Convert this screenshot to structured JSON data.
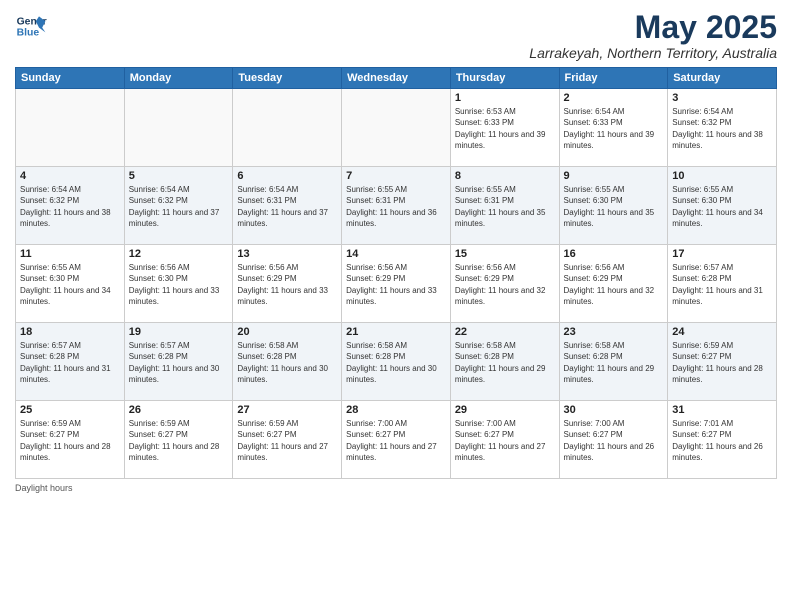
{
  "header": {
    "logo_line1": "General",
    "logo_line2": "Blue",
    "month": "May 2025",
    "location": "Larrakeyah, Northern Territory, Australia"
  },
  "days_of_week": [
    "Sunday",
    "Monday",
    "Tuesday",
    "Wednesday",
    "Thursday",
    "Friday",
    "Saturday"
  ],
  "footer": "Daylight hours",
  "weeks": [
    [
      {
        "day": "",
        "info": ""
      },
      {
        "day": "",
        "info": ""
      },
      {
        "day": "",
        "info": ""
      },
      {
        "day": "",
        "info": ""
      },
      {
        "day": "1",
        "info": "Sunrise: 6:53 AM\nSunset: 6:33 PM\nDaylight: 11 hours and 39 minutes."
      },
      {
        "day": "2",
        "info": "Sunrise: 6:54 AM\nSunset: 6:33 PM\nDaylight: 11 hours and 39 minutes."
      },
      {
        "day": "3",
        "info": "Sunrise: 6:54 AM\nSunset: 6:32 PM\nDaylight: 11 hours and 38 minutes."
      }
    ],
    [
      {
        "day": "4",
        "info": "Sunrise: 6:54 AM\nSunset: 6:32 PM\nDaylight: 11 hours and 38 minutes."
      },
      {
        "day": "5",
        "info": "Sunrise: 6:54 AM\nSunset: 6:32 PM\nDaylight: 11 hours and 37 minutes."
      },
      {
        "day": "6",
        "info": "Sunrise: 6:54 AM\nSunset: 6:31 PM\nDaylight: 11 hours and 37 minutes."
      },
      {
        "day": "7",
        "info": "Sunrise: 6:55 AM\nSunset: 6:31 PM\nDaylight: 11 hours and 36 minutes."
      },
      {
        "day": "8",
        "info": "Sunrise: 6:55 AM\nSunset: 6:31 PM\nDaylight: 11 hours and 35 minutes."
      },
      {
        "day": "9",
        "info": "Sunrise: 6:55 AM\nSunset: 6:30 PM\nDaylight: 11 hours and 35 minutes."
      },
      {
        "day": "10",
        "info": "Sunrise: 6:55 AM\nSunset: 6:30 PM\nDaylight: 11 hours and 34 minutes."
      }
    ],
    [
      {
        "day": "11",
        "info": "Sunrise: 6:55 AM\nSunset: 6:30 PM\nDaylight: 11 hours and 34 minutes."
      },
      {
        "day": "12",
        "info": "Sunrise: 6:56 AM\nSunset: 6:30 PM\nDaylight: 11 hours and 33 minutes."
      },
      {
        "day": "13",
        "info": "Sunrise: 6:56 AM\nSunset: 6:29 PM\nDaylight: 11 hours and 33 minutes."
      },
      {
        "day": "14",
        "info": "Sunrise: 6:56 AM\nSunset: 6:29 PM\nDaylight: 11 hours and 33 minutes."
      },
      {
        "day": "15",
        "info": "Sunrise: 6:56 AM\nSunset: 6:29 PM\nDaylight: 11 hours and 32 minutes."
      },
      {
        "day": "16",
        "info": "Sunrise: 6:56 AM\nSunset: 6:29 PM\nDaylight: 11 hours and 32 minutes."
      },
      {
        "day": "17",
        "info": "Sunrise: 6:57 AM\nSunset: 6:28 PM\nDaylight: 11 hours and 31 minutes."
      }
    ],
    [
      {
        "day": "18",
        "info": "Sunrise: 6:57 AM\nSunset: 6:28 PM\nDaylight: 11 hours and 31 minutes."
      },
      {
        "day": "19",
        "info": "Sunrise: 6:57 AM\nSunset: 6:28 PM\nDaylight: 11 hours and 30 minutes."
      },
      {
        "day": "20",
        "info": "Sunrise: 6:58 AM\nSunset: 6:28 PM\nDaylight: 11 hours and 30 minutes."
      },
      {
        "day": "21",
        "info": "Sunrise: 6:58 AM\nSunset: 6:28 PM\nDaylight: 11 hours and 30 minutes."
      },
      {
        "day": "22",
        "info": "Sunrise: 6:58 AM\nSunset: 6:28 PM\nDaylight: 11 hours and 29 minutes."
      },
      {
        "day": "23",
        "info": "Sunrise: 6:58 AM\nSunset: 6:28 PM\nDaylight: 11 hours and 29 minutes."
      },
      {
        "day": "24",
        "info": "Sunrise: 6:59 AM\nSunset: 6:27 PM\nDaylight: 11 hours and 28 minutes."
      }
    ],
    [
      {
        "day": "25",
        "info": "Sunrise: 6:59 AM\nSunset: 6:27 PM\nDaylight: 11 hours and 28 minutes."
      },
      {
        "day": "26",
        "info": "Sunrise: 6:59 AM\nSunset: 6:27 PM\nDaylight: 11 hours and 28 minutes."
      },
      {
        "day": "27",
        "info": "Sunrise: 6:59 AM\nSunset: 6:27 PM\nDaylight: 11 hours and 27 minutes."
      },
      {
        "day": "28",
        "info": "Sunrise: 7:00 AM\nSunset: 6:27 PM\nDaylight: 11 hours and 27 minutes."
      },
      {
        "day": "29",
        "info": "Sunrise: 7:00 AM\nSunset: 6:27 PM\nDaylight: 11 hours and 27 minutes."
      },
      {
        "day": "30",
        "info": "Sunrise: 7:00 AM\nSunset: 6:27 PM\nDaylight: 11 hours and 26 minutes."
      },
      {
        "day": "31",
        "info": "Sunrise: 7:01 AM\nSunset: 6:27 PM\nDaylight: 11 hours and 26 minutes."
      }
    ]
  ]
}
